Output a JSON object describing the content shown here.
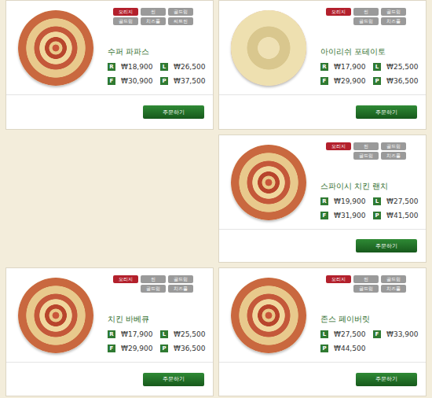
{
  "pizzas": [
    {
      "name": "수퍼 파파스",
      "tags": [
        {
          "label": "오리지",
          "selected": true
        },
        {
          "label": "씬",
          "selected": false
        },
        {
          "label": "골드링",
          "selected": false
        },
        {
          "label": "골드링",
          "selected": false
        },
        {
          "label": "치즈롤",
          "selected": false
        },
        {
          "label": "씨트씬",
          "selected": false
        }
      ],
      "prices": [
        {
          "size": "R",
          "price": "₩18,900"
        },
        {
          "size": "L",
          "price": "₩26,500"
        },
        {
          "size": "F",
          "price": "₩30,900"
        },
        {
          "size": "P",
          "price": "₩37,500"
        }
      ],
      "button": "주문하기"
    },
    {
      "name": "아이리쉬 포테이토",
      "tags": [
        {
          "label": "오리지",
          "selected": true
        },
        {
          "label": "씬",
          "selected": false
        },
        {
          "label": "골드링",
          "selected": false
        },
        {
          "label": "골드링",
          "selected": false
        },
        {
          "label": "치즈롤",
          "selected": false
        }
      ],
      "prices": [
        {
          "size": "R",
          "price": "₩17,900"
        },
        {
          "size": "L",
          "price": "₩25,500"
        },
        {
          "size": "F",
          "price": "₩29,900"
        },
        {
          "size": "P",
          "price": "₩36,500"
        }
      ],
      "button": "주문하기"
    },
    {
      "name": "스파이시 치킨 랜치",
      "tags": [
        {
          "label": "오리지",
          "selected": true
        },
        {
          "label": "씬",
          "selected": false
        },
        {
          "label": "골드링",
          "selected": false
        },
        {
          "label": "골드링",
          "selected": false
        },
        {
          "label": "치즈롤",
          "selected": false
        }
      ],
      "prices": [
        {
          "size": "R",
          "price": "₩19,900"
        },
        {
          "size": "L",
          "price": "₩27,500"
        },
        {
          "size": "F",
          "price": "₩31,900"
        },
        {
          "size": "P",
          "price": "₩41,500"
        }
      ],
      "button": "주문하기"
    },
    {
      "name": "치킨 바베큐",
      "tags": [
        {
          "label": "오리지",
          "selected": true
        },
        {
          "label": "씬",
          "selected": false
        },
        {
          "label": "골드링",
          "selected": false
        },
        {
          "label": "골드링",
          "selected": false
        },
        {
          "label": "치즈롤",
          "selected": false
        }
      ],
      "prices": [
        {
          "size": "R",
          "price": "₩17,900"
        },
        {
          "size": "L",
          "price": "₩25,500"
        },
        {
          "size": "F",
          "price": "₩29,900"
        },
        {
          "size": "P",
          "price": "₩36,500"
        }
      ],
      "button": "주문하기"
    },
    {
      "name": "존스 페이버릿",
      "tags": [
        {
          "label": "오리지",
          "selected": true
        },
        {
          "label": "씬",
          "selected": false
        },
        {
          "label": "골드링",
          "selected": false
        },
        {
          "label": "골드링",
          "selected": false
        },
        {
          "label": "치즈롤",
          "selected": false
        }
      ],
      "prices": [
        {
          "size": "L",
          "price": "₩27,500"
        },
        {
          "size": "F",
          "price": "₩33,900"
        },
        {
          "size": "P",
          "price": "₩44,500"
        }
      ],
      "button": "주문하기"
    }
  ]
}
